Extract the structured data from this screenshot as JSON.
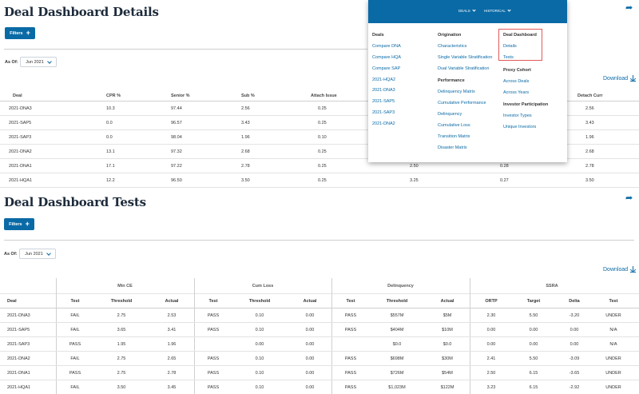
{
  "section1": {
    "title": "Deal Dashboard Details",
    "filters_label": "Filters",
    "as_of_label": "As Of:",
    "as_of_value": "Jun 2021",
    "download_label": "Download",
    "columns": [
      "Deal",
      "CPR %",
      "Senior %",
      "Sub %",
      "Attach Issue",
      "Detach Curr"
    ],
    "rows": [
      {
        "deal": "2021-DNA3",
        "cpr": "10.3",
        "senior": "97.44",
        "sub": "2.56",
        "attach": "0.25",
        "detach": "2.56"
      },
      {
        "deal": "2021-SAP5",
        "cpr": "0.0",
        "senior": "96.57",
        "sub": "3.43",
        "attach": "0.25",
        "detach": "3.43"
      },
      {
        "deal": "2021-SAP3",
        "cpr": "0.0",
        "senior": "98.04",
        "sub": "1.96",
        "attach": "0.10",
        "detach": "1.96"
      },
      {
        "deal": "2021-DNA2",
        "cpr": "13.1",
        "senior": "97.32",
        "sub": "2.68",
        "attach": "0.25",
        "detach": "2.68"
      },
      {
        "deal": "2021-DNA1",
        "cpr": "17.1",
        "senior": "97.22",
        "sub": "2.78",
        "attach": "0.25",
        "mid1": "2.50",
        "mid2": "0.28",
        "detach": "2.78"
      },
      {
        "deal": "2021-HQA1",
        "cpr": "12.2",
        "senior": "96.50",
        "sub": "3.50",
        "attach": "0.25",
        "mid1": "3.25",
        "mid2": "0.27",
        "detach": "3.50"
      }
    ]
  },
  "menu": {
    "top": {
      "deals": "DEALS",
      "historical": "HISTORICAL"
    },
    "deals": {
      "heading": "Deals",
      "links": [
        "Compare DNA",
        "Compare HQA",
        "Compare SAP",
        "2021-HQA2",
        "2021-DNA3",
        "2021-SAP5",
        "2021-SAP3",
        "2021-DNA2"
      ]
    },
    "origination": {
      "heading": "Origination",
      "links": [
        "Characteristics",
        "Single Variable Stratification",
        "Dual Variable Stratification"
      ]
    },
    "performance": {
      "heading": "Performance",
      "links": [
        "Delinquency Matrix",
        "Cumulative Performance",
        "Delinquency",
        "Cumulative Loss",
        "Transition Matrix",
        "Disaster Matrix"
      ]
    },
    "deal_dashboard": {
      "heading": "Deal Dashboard",
      "links": [
        "Details",
        "Tests"
      ]
    },
    "proxy_cohort": {
      "heading": "Proxy Cohort",
      "links": [
        "Across Deals",
        "Across Years"
      ]
    },
    "investor_participation": {
      "heading": "Investor Participation",
      "links": [
        "Investor Types",
        "Unique Investors"
      ]
    }
  },
  "section2": {
    "title": "Deal Dashboard Tests",
    "filters_label": "Filters",
    "as_of_label": "As Of:",
    "as_of_value": "Jun 2021",
    "download_label": "Download",
    "groups": [
      "Min CE",
      "Cum Loss",
      "Delinquency",
      "SSRA"
    ],
    "columns": [
      "Deal",
      "Test",
      "Threshold",
      "Actual",
      "Test",
      "Threshold",
      "Actual",
      "Test",
      "Threshold",
      "Actual",
      "ORTP",
      "Target",
      "Delta",
      "Test"
    ],
    "rows": [
      [
        "2021-DNA3",
        "FAIL",
        "2.75",
        "2.53",
        "PASS",
        "0.10",
        "0.00",
        "PASS",
        "$557M",
        "$5M",
        "2.30",
        "5.50",
        "-3.20",
        "UNDER"
      ],
      [
        "2021-SAP5",
        "FAIL",
        "3.65",
        "3.41",
        "PASS",
        "0.10",
        "0.00",
        "PASS",
        "$404M",
        "$10M",
        "0.00",
        "0.00",
        "0.00",
        "N/A"
      ],
      [
        "2021-SAP3",
        "PASS",
        "1.95",
        "1.96",
        "",
        "0.00",
        "0.00",
        "",
        "$0.0",
        "$0.0",
        "0.00",
        "0.00",
        "0.00",
        "N/A"
      ],
      [
        "2021-DNA2",
        "FAIL",
        "2.75",
        "2.65",
        "PASS",
        "0.10",
        "0.00",
        "PASS",
        "$698M",
        "$30M",
        "2.41",
        "5.50",
        "-3.09",
        "UNDER"
      ],
      [
        "2021-DNA1",
        "PASS",
        "2.75",
        "2.78",
        "PASS",
        "0.10",
        "0.00",
        "PASS",
        "$726M",
        "$54M",
        "2.50",
        "6.15",
        "-3.65",
        "UNDER"
      ],
      [
        "2021-HQA1",
        "FAIL",
        "3.50",
        "3.45",
        "PASS",
        "0.10",
        "0.00",
        "PASS",
        "$1,023M",
        "$122M",
        "3.23",
        "6.15",
        "-2.92",
        "UNDER"
      ]
    ]
  },
  "icons": {
    "share": "share-arrow-icon",
    "download": "download-icon",
    "plus": "plus-icon",
    "chevron": "chevron-down-icon"
  },
  "colors": {
    "accent": "#0a6aa6",
    "title": "#1c2a3a",
    "highlight": "#e05a5a"
  }
}
